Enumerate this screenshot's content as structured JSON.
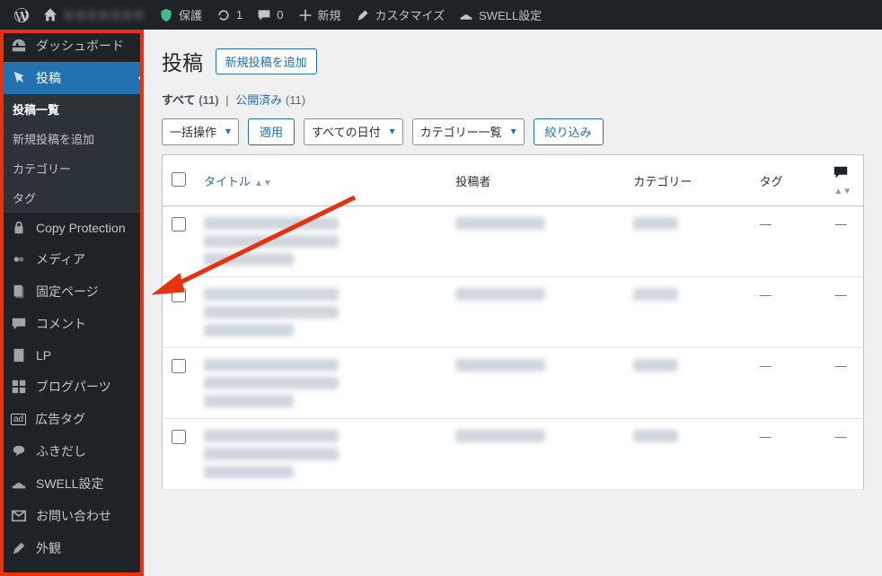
{
  "adminbar": {
    "site_name": "＊＊＊＊＊＊＊",
    "protect": "保護",
    "updates_count": "1",
    "comments_count": "0",
    "new": "新規",
    "customize": "カスタマイズ",
    "swell": "SWELL設定"
  },
  "sidebar": {
    "dashboard": "ダッシュボード",
    "posts": "投稿",
    "posts_sub": {
      "all": "投稿一覧",
      "new": "新規投稿を追加",
      "cat": "カテゴリー",
      "tag": "タグ"
    },
    "copy": "Copy Protection",
    "media": "メディア",
    "pages": "固定ページ",
    "comments": "コメント",
    "lp": "LP",
    "blogparts": "ブログパーツ",
    "adtag": "広告タグ",
    "balloon": "ふきだし",
    "swell": "SWELL設定",
    "contact": "お問い合わせ",
    "appearance": "外観"
  },
  "page": {
    "title": "投稿",
    "add_new": "新規投稿を追加"
  },
  "subsubsub": {
    "all": "すべて",
    "all_cnt": "(11)",
    "sep": "|",
    "published": "公開済み",
    "published_cnt": "(11)"
  },
  "tablenav": {
    "bulk": "一括操作",
    "apply": "適用",
    "dates": "すべての日付",
    "cats": "カテゴリー一覧",
    "filter": "絞り込み"
  },
  "columns": {
    "title": "タイトル",
    "author": "投稿者",
    "categories": "カテゴリー",
    "tags": "タグ"
  },
  "rows": [
    {
      "tags": "—",
      "comments": "—"
    },
    {
      "tags": "—",
      "comments": "—"
    },
    {
      "tags": "—",
      "comments": "—"
    },
    {
      "tags": "—",
      "comments": "—"
    }
  ]
}
